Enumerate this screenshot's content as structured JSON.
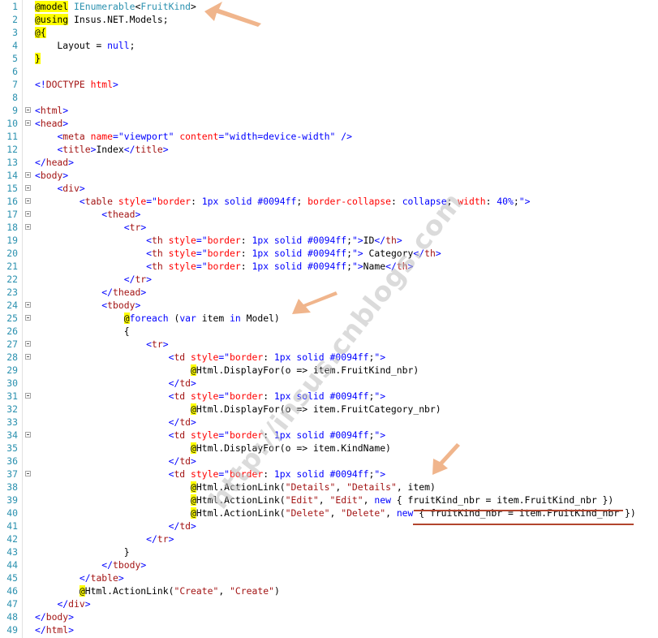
{
  "lines": [
    {
      "n": "1",
      "html": "<span class='raz'>@model</span> <span class='ty'>IEnumerable</span>&lt;<span class='ty'>FruitKind</span>&gt;"
    },
    {
      "n": "2",
      "html": "<span class='raz'>@using</span> Insus.NET.Models;"
    },
    {
      "n": "3",
      "html": "<span class='raz'>@{</span>"
    },
    {
      "n": "4",
      "html": "    Layout = <span class='k'>null</span>;"
    },
    {
      "n": "5",
      "html": "<span class='raz'>}</span>"
    },
    {
      "n": "6",
      "html": ""
    },
    {
      "n": "7",
      "html": "<span class='k'>&lt;!</span><span class='t'>DOCTYPE</span> <span class='a'>html</span><span class='k'>&gt;</span>"
    },
    {
      "n": "8",
      "html": ""
    },
    {
      "n": "9",
      "html": "<span class='k'>&lt;</span><span class='t'>html</span><span class='k'>&gt;</span>",
      "fold": true
    },
    {
      "n": "10",
      "html": "<span class='k'>&lt;</span><span class='t'>head</span><span class='k'>&gt;</span>",
      "fold": true
    },
    {
      "n": "11",
      "html": "    <span class='k'>&lt;</span><span class='t'>meta</span> <span class='a'>name</span><span class='k'>=\"viewport\"</span> <span class='a'>content</span><span class='k'>=\"width=device-width\"</span> <span class='k'>/&gt;</span>"
    },
    {
      "n": "12",
      "html": "    <span class='k'>&lt;</span><span class='t'>title</span><span class='k'>&gt;</span>Index<span class='k'>&lt;/</span><span class='t'>title</span><span class='k'>&gt;</span>"
    },
    {
      "n": "13",
      "html": "<span class='k'>&lt;/</span><span class='t'>head</span><span class='k'>&gt;</span>"
    },
    {
      "n": "14",
      "html": "<span class='k'>&lt;</span><span class='t'>body</span><span class='k'>&gt;</span>",
      "fold": true
    },
    {
      "n": "15",
      "html": "    <span class='k'>&lt;</span><span class='t'>div</span><span class='k'>&gt;</span>",
      "fold": true
    },
    {
      "n": "16",
      "html": "        <span class='k'>&lt;</span><span class='t'>table</span> <span class='a'>style</span><span class='k'>=\"</span><span class='a'>border</span>: <span class='s'>1px solid #0094ff</span>; <span class='a'>border-collapse</span>: <span class='s'>collapse</span>; <span class='a'>width</span>: <span class='s'>40%</span>;<span class='k'>\"&gt;</span>",
      "fold": true
    },
    {
      "n": "17",
      "html": "            <span class='k'>&lt;</span><span class='t'>thead</span><span class='k'>&gt;</span>",
      "fold": true
    },
    {
      "n": "18",
      "html": "                <span class='k'>&lt;</span><span class='t'>tr</span><span class='k'>&gt;</span>",
      "fold": true
    },
    {
      "n": "19",
      "html": "                    <span class='k'>&lt;</span><span class='t'>th</span> <span class='a'>style</span><span class='k'>=\"</span><span class='a'>border</span>: <span class='s'>1px solid #0094ff</span>;<span class='k'>\"&gt;</span>ID<span class='k'>&lt;/</span><span class='t'>th</span><span class='k'>&gt;</span>"
    },
    {
      "n": "20",
      "html": "                    <span class='k'>&lt;</span><span class='t'>th</span> <span class='a'>style</span><span class='k'>=\"</span><span class='a'>border</span>: <span class='s'>1px solid #0094ff</span>;<span class='k'>\"&gt;</span> Category<span class='k'>&lt;/</span><span class='t'>th</span><span class='k'>&gt;</span>"
    },
    {
      "n": "21",
      "html": "                    <span class='k'>&lt;</span><span class='t'>th</span> <span class='a'>style</span><span class='k'>=\"</span><span class='a'>border</span>: <span class='s'>1px solid #0094ff</span>;<span class='k'>\"&gt;</span>Name<span class='k'>&lt;/</span><span class='t'>th</span><span class='k'>&gt;</span>"
    },
    {
      "n": "22",
      "html": "                <span class='k'>&lt;/</span><span class='t'>tr</span><span class='k'>&gt;</span>"
    },
    {
      "n": "23",
      "html": "            <span class='k'>&lt;/</span><span class='t'>thead</span><span class='k'>&gt;</span>"
    },
    {
      "n": "24",
      "html": "            <span class='k'>&lt;</span><span class='t'>tbody</span><span class='k'>&gt;</span>",
      "fold": true
    },
    {
      "n": "25",
      "html": "                <span class='raz'>@</span><span class='k'>foreach</span> (<span class='k'>var</span> item <span class='k'>in</span> Model)",
      "fold": true
    },
    {
      "n": "26",
      "html": "                {"
    },
    {
      "n": "27",
      "html": "                    <span class='k'>&lt;</span><span class='t'>tr</span><span class='k'>&gt;</span>",
      "fold": true
    },
    {
      "n": "28",
      "html": "                        <span class='k'>&lt;</span><span class='t'>td</span> <span class='a'>style</span><span class='k'>=\"</span><span class='a'>border</span>: <span class='s'>1px solid #0094ff</span>;<span class='k'>\"&gt;</span>",
      "fold": true
    },
    {
      "n": "29",
      "html": "                            <span class='raz'>@</span>Html.DisplayFor(o =&gt; item.FruitKind_nbr)"
    },
    {
      "n": "30",
      "html": "                        <span class='k'>&lt;/</span><span class='t'>td</span><span class='k'>&gt;</span>"
    },
    {
      "n": "31",
      "html": "                        <span class='k'>&lt;</span><span class='t'>td</span> <span class='a'>style</span><span class='k'>=\"</span><span class='a'>border</span>: <span class='s'>1px solid #0094ff</span>;<span class='k'>\"&gt;</span>",
      "fold": true
    },
    {
      "n": "32",
      "html": "                            <span class='raz'>@</span>Html.DisplayFor(o =&gt; item.FruitCategory_nbr)"
    },
    {
      "n": "33",
      "html": "                        <span class='k'>&lt;/</span><span class='t'>td</span><span class='k'>&gt;</span>"
    },
    {
      "n": "34",
      "html": "                        <span class='k'>&lt;</span><span class='t'>td</span> <span class='a'>style</span><span class='k'>=\"</span><span class='a'>border</span>: <span class='s'>1px solid #0094ff</span>;<span class='k'>\"&gt;</span>",
      "fold": true
    },
    {
      "n": "35",
      "html": "                            <span class='raz'>@</span>Html.DisplayFor(o =&gt; item.KindName)"
    },
    {
      "n": "36",
      "html": "                        <span class='k'>&lt;/</span><span class='t'>td</span><span class='k'>&gt;</span>"
    },
    {
      "n": "37",
      "html": "                        <span class='k'>&lt;</span><span class='t'>td</span> <span class='a'>style</span><span class='k'>=\"</span><span class='a'>border</span>: <span class='s'>1px solid #0094ff</span>;<span class='k'>\"&gt;</span>",
      "fold": true
    },
    {
      "n": "38",
      "html": "                            <span class='raz'>@</span>Html.ActionLink(<span class='str'>\"Details\"</span>, <span class='str'>\"Details\"</span>, item)"
    },
    {
      "n": "39",
      "html": "                            <span class='raz'>@</span>Html.ActionLink(<span class='str'>\"Edit\"</span>, <span class='str'>\"Edit\"</span>, <span class='k'>new</span> { fruitKind_nbr = item.FruitKind_nbr })"
    },
    {
      "n": "40",
      "html": "                            <span class='raz'>@</span>Html.ActionLink(<span class='str'>\"Delete\"</span>, <span class='str'>\"Delete\"</span>, <span class='k'>new</span> { fruitKind_nbr = item.FruitKind_nbr })"
    },
    {
      "n": "41",
      "html": "                        <span class='k'>&lt;/</span><span class='t'>td</span><span class='k'>&gt;</span>"
    },
    {
      "n": "42",
      "html": "                    <span class='k'>&lt;/</span><span class='t'>tr</span><span class='k'>&gt;</span>"
    },
    {
      "n": "43",
      "html": "                }"
    },
    {
      "n": "44",
      "html": "            <span class='k'>&lt;/</span><span class='t'>tbody</span><span class='k'>&gt;</span>"
    },
    {
      "n": "45",
      "html": "        <span class='k'>&lt;/</span><span class='t'>table</span><span class='k'>&gt;</span>"
    },
    {
      "n": "46",
      "html": "        <span class='raz'>@</span>Html.ActionLink(<span class='str'>\"Create\"</span>, <span class='str'>\"Create\"</span>)"
    },
    {
      "n": "47",
      "html": "    <span class='k'>&lt;/</span><span class='t'>div</span><span class='k'>&gt;</span>"
    },
    {
      "n": "48",
      "html": "<span class='k'>&lt;/</span><span class='t'>body</span><span class='k'>&gt;</span>"
    },
    {
      "n": "49",
      "html": "<span class='k'>&lt;/</span><span class='t'>html</span><span class='k'>&gt;</span>"
    }
  ],
  "watermark": "http://insus.cnblogs.com",
  "colors": {
    "arrow": "#f0b58c",
    "underline": "#b2452e",
    "highlight": "#ffff00",
    "line_number": "#2b91af"
  }
}
